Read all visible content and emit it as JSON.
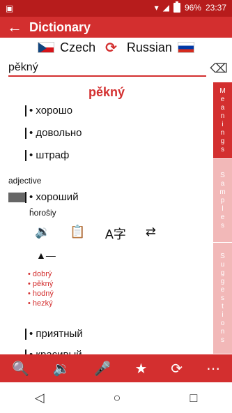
{
  "status": {
    "left": "▣",
    "battery": "96%",
    "time": "23:37"
  },
  "appbar": {
    "back_icon": "←",
    "title": "Dictionary"
  },
  "langs": {
    "from": "Czech",
    "to": "Russian",
    "swap_icon": "⟳"
  },
  "search": {
    "value": "pěkný",
    "clear_icon": "⌫"
  },
  "entry": {
    "headword": "pěkný",
    "meanings1": [
      "• хорошо",
      "• довольно",
      "• штраф"
    ],
    "pos": "adjective",
    "meaning2": "• хороший",
    "translit": "ĥoroŝiy",
    "actions": [
      "🔉",
      "📋",
      "A字",
      "⇄"
    ],
    "dash": "▲—",
    "synonyms": [
      "• dobrý",
      "• pěkný",
      "• hodný",
      "• hezký"
    ],
    "meaning3": "• приятный",
    "meaning4": "• красивый"
  },
  "sidetabs": [
    {
      "label": "Meanings",
      "active": true
    },
    {
      "label": "Samples",
      "active": false
    },
    {
      "label": "Suggestions",
      "active": false
    }
  ],
  "bottombar": [
    "🔍",
    "🔉",
    "🎤",
    "★",
    "⟳",
    "⋯"
  ],
  "navbar": [
    "◁",
    "○",
    "□"
  ]
}
